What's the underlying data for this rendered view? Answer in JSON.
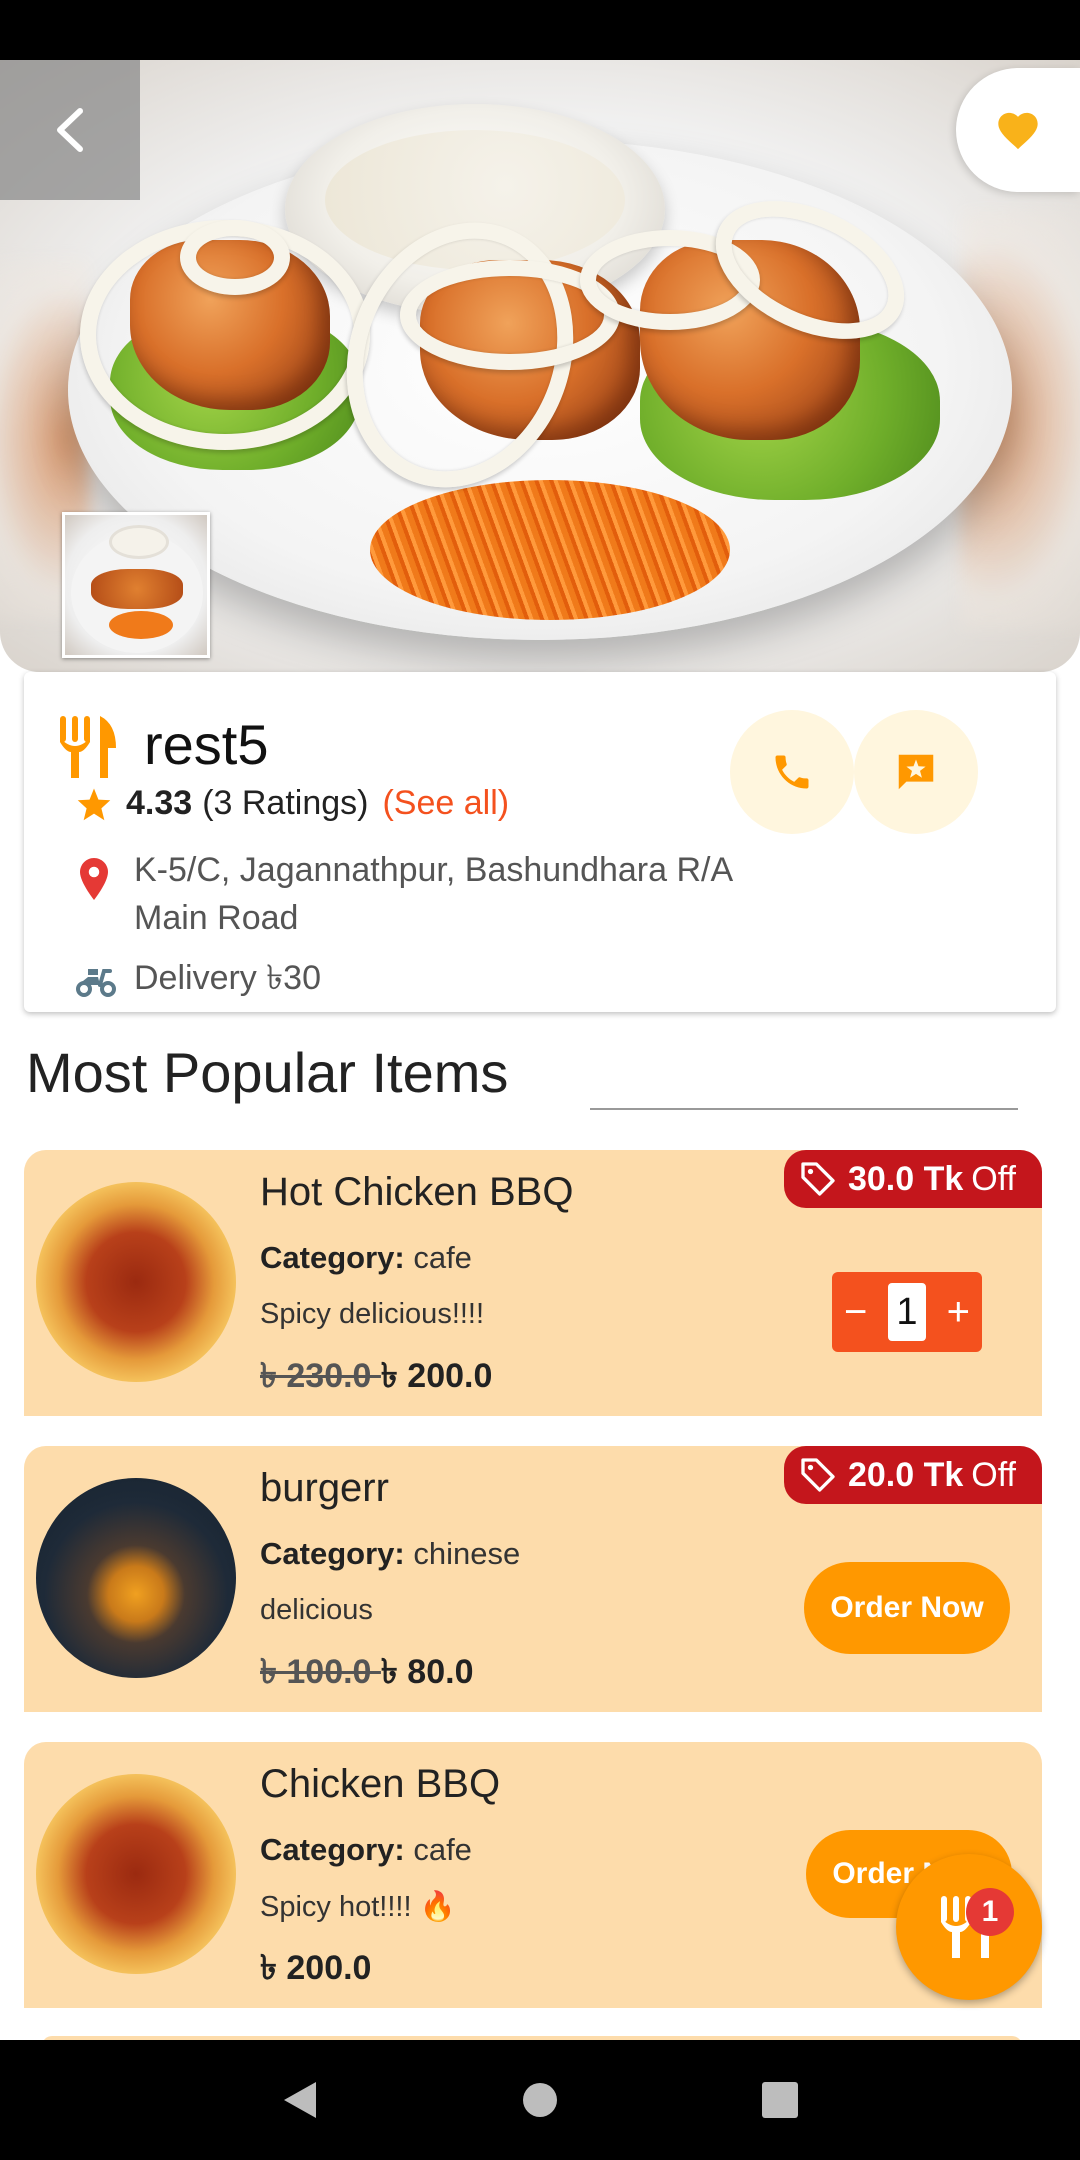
{
  "app": {
    "accent": "#ff9800",
    "discount_color": "#c4161c",
    "card_color": "#fddcab"
  },
  "hero": {
    "back_icon": "chevron-left-icon",
    "favorite_icon": "heart-icon"
  },
  "restaurant": {
    "name": "rest5",
    "rating_value": "4.33",
    "rating_count": "(3 Ratings)",
    "see_all": "(See all)",
    "address": "K-5/C, Jagannathpur, Bashundhara R/A Main Road",
    "delivery": "Delivery ৳30"
  },
  "section": {
    "title": "Most Popular Items"
  },
  "items": [
    {
      "name": "Hot Chicken BBQ",
      "category_label": "Category:",
      "category": "cafe",
      "description": "Spicy delicious!!!!",
      "old_price": "৳ 230.0 ",
      "price": "৳ 200.0",
      "discount_amount": "30.0 Tk",
      "discount_suffix": "Off",
      "quantity": "1",
      "minus": "−",
      "plus": "+"
    },
    {
      "name": "burgerr",
      "category_label": "Category:",
      "category": "chinese",
      "description": "delicious",
      "old_price": "৳ 100.0 ",
      "price": "৳ 80.0",
      "discount_amount": "20.0 Tk",
      "discount_suffix": "Off",
      "action": "Order Now"
    },
    {
      "name": "Chicken BBQ",
      "category_label": "Category:",
      "category": "cafe",
      "description": "Spicy hot!!!! 🔥",
      "price": "৳ 200.0",
      "action": "Order Now"
    }
  ],
  "cart": {
    "count": "1"
  }
}
